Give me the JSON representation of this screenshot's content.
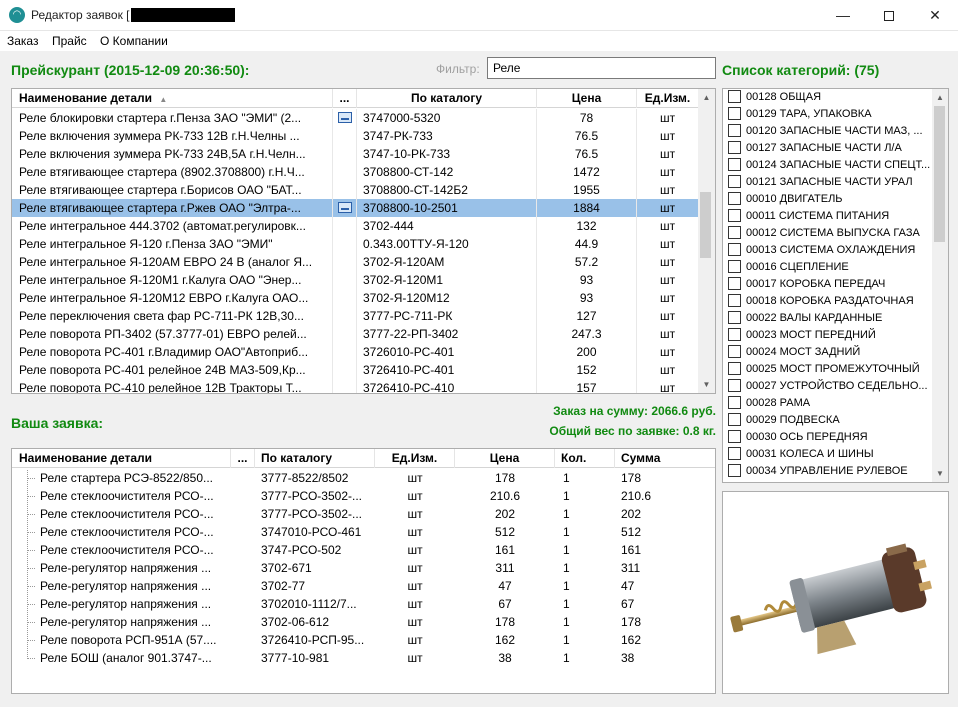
{
  "window": {
    "title": "Редактор заявок  [",
    "minimize": "—",
    "close": "✕"
  },
  "menu": [
    "Заказ",
    "Прайс",
    "О Компании"
  ],
  "price": {
    "title": "Прейскурант (2015-12-09 20:36:50):",
    "filter_label": "Фильтр:",
    "filter_value": "Реле",
    "columns": {
      "name": "Наименование детали",
      "sort_arrow": "▲",
      "pic": "...",
      "catalog": "По каталогу",
      "price": "Цена",
      "unit": "Ед.Изм."
    },
    "rows": [
      {
        "name": "Реле блокировки стартера г.Пенза ЗАО \"ЭМИ\" (2...",
        "pic": true,
        "catalog": "3747000-5320",
        "price": "78",
        "unit": "шт"
      },
      {
        "name": "Реле включения зуммера РК-733 12В г.Н.Челны ...",
        "pic": false,
        "catalog": "3747-РК-733",
        "price": "76.5",
        "unit": "шт"
      },
      {
        "name": "Реле включения зуммера РК-733 24В,5А г.Н.Челн...",
        "pic": false,
        "catalog": "3747-10-РК-733",
        "price": "76.5",
        "unit": "шт"
      },
      {
        "name": "Реле втягивающее стартера (8902.3708800) г.Н.Ч...",
        "pic": false,
        "catalog": "3708800-СТ-142",
        "price": "1472",
        "unit": "шт"
      },
      {
        "name": "Реле втягивающее стартера г.Борисов ОАО \"БАТ...",
        "pic": false,
        "catalog": "3708800-СТ-142Б2",
        "price": "1955",
        "unit": "шт"
      },
      {
        "name": "Реле втягивающее стартера г.Ржев ОАО \"Элтра-...",
        "pic": true,
        "catalog": "3708800-10-2501",
        "price": "1884",
        "unit": "шт",
        "selected": true
      },
      {
        "name": "Реле интегральное 444.3702 (автомат.регулировк...",
        "pic": false,
        "catalog": "3702-444",
        "price": "132",
        "unit": "шт"
      },
      {
        "name": "Реле интегральное Я-120 г.Пенза ЗАО \"ЭМИ\"",
        "pic": false,
        "catalog": "0.343.00ТТУ-Я-120",
        "price": "44.9",
        "unit": "шт"
      },
      {
        "name": "Реле интегральное Я-120АМ ЕВРО 24 В (аналог Я...",
        "pic": false,
        "catalog": "3702-Я-120АМ",
        "price": "57.2",
        "unit": "шт"
      },
      {
        "name": "Реле интегральное Я-120М1 г.Калуга ОАО \"Энер...",
        "pic": false,
        "catalog": "3702-Я-120М1",
        "price": "93",
        "unit": "шт"
      },
      {
        "name": "Реле интегральное Я-120М12 ЕВРО г.Калуга ОАО...",
        "pic": false,
        "catalog": "3702-Я-120М12",
        "price": "93",
        "unit": "шт"
      },
      {
        "name": "Реле переключения света фар РС-711-РК 12В,30...",
        "pic": false,
        "catalog": "3777-РС-711-РК",
        "price": "127",
        "unit": "шт"
      },
      {
        "name": "Реле поворота РП-3402 (57.3777-01) ЕВРО релей...",
        "pic": false,
        "catalog": "3777-22-РП-3402",
        "price": "247.3",
        "unit": "шт"
      },
      {
        "name": "Реле поворота РС-401 г.Владимир ОАО\"Автоприб...",
        "pic": false,
        "catalog": "3726010-РС-401",
        "price": "200",
        "unit": "шт"
      },
      {
        "name": "Реле поворота РС-401 релейное 24В МАЗ-509,Кр...",
        "pic": false,
        "catalog": "3726410-РС-401",
        "price": "152",
        "unit": "шт"
      },
      {
        "name": "Реле поворота РС-410 релейное 12В Тракторы Т...",
        "pic": false,
        "catalog": "3726410-РС-410",
        "price": "157",
        "unit": "шт"
      }
    ]
  },
  "order": {
    "title": "Ваша заявка:",
    "total_sum": "Заказ на сумму: 2066.6 руб.",
    "total_weight": "Общий вес по заявке: 0.8 кг.",
    "columns": {
      "name": "Наименование детали",
      "pic": "...",
      "catalog": "По каталогу",
      "unit": "Ед.Изм.",
      "price": "Цена",
      "qty": "Кол.",
      "sum": "Сумма"
    },
    "rows": [
      {
        "name": "Реле стартера  РСЭ-8522/850...",
        "catalog": "3777-8522/8502",
        "unit": "шт",
        "price": "178",
        "qty": "1",
        "sum": "178"
      },
      {
        "name": "Реле стеклоочистителя РСО-...",
        "catalog": "3777-РСО-3502-...",
        "unit": "шт",
        "price": "210.6",
        "qty": "1",
        "sum": "210.6"
      },
      {
        "name": "Реле стеклоочистителя РСО-...",
        "catalog": "3777-РСО-3502-...",
        "unit": "шт",
        "price": "202",
        "qty": "1",
        "sum": "202"
      },
      {
        "name": "Реле стеклоочистителя РСО-...",
        "catalog": "3747010-РСО-461",
        "unit": "шт",
        "price": "512",
        "qty": "1",
        "sum": "512"
      },
      {
        "name": "Реле стеклоочистителя РСО-...",
        "catalog": "3747-РСО-502",
        "unit": "шт",
        "price": "161",
        "qty": "1",
        "sum": "161"
      },
      {
        "name": "Реле-регулятор напряжения ...",
        "catalog": "3702-671",
        "unit": "шт",
        "price": "311",
        "qty": "1",
        "sum": "311"
      },
      {
        "name": "Реле-регулятор напряжения ...",
        "catalog": "3702-77",
        "unit": "шт",
        "price": "47",
        "qty": "1",
        "sum": "47"
      },
      {
        "name": "Реле-регулятор напряжения ...",
        "catalog": "3702010-1112/7...",
        "unit": "шт",
        "price": "67",
        "qty": "1",
        "sum": "67"
      },
      {
        "name": "Реле-регулятор напряжения ...",
        "catalog": "3702-06-612",
        "unit": "шт",
        "price": "178",
        "qty": "1",
        "sum": "178"
      },
      {
        "name": "Реле поворота РСП-951А (57....",
        "catalog": "3726410-РСП-95...",
        "unit": "шт",
        "price": "162",
        "qty": "1",
        "sum": "162"
      },
      {
        "name": "Реле БОШ (аналог 901.3747-...",
        "catalog": "3777-10-981",
        "unit": "шт",
        "price": "38",
        "qty": "1",
        "sum": "38"
      }
    ]
  },
  "categories": {
    "title": "Список категорий: (75)",
    "items": [
      "00128 ОБЩАЯ",
      "00129 ТАРА, УПАКОВКА",
      "00120 ЗАПАСНЫЕ ЧАСТИ МАЗ, ...",
      "00127 ЗАПАСНЫЕ ЧАСТИ Л/А",
      "00124 ЗАПАСНЫЕ ЧАСТИ СПЕЦТ...",
      "00121 ЗАПАСНЫЕ ЧАСТИ УРАЛ",
      "00010 ДВИГАТЕЛЬ",
      "00011 СИСТЕМА ПИТАНИЯ",
      "00012 СИСТЕМА ВЫПУСКА ГАЗА",
      "00013 СИСТЕМА ОХЛАЖДЕНИЯ",
      "00016 СЦЕПЛЕНИЕ",
      "00017 КОРОБКА ПЕРЕДАЧ",
      "00018 КОРОБКА РАЗДАТОЧНАЯ",
      "00022 ВАЛЫ КАРДАННЫЕ",
      "00023 МОСТ ПЕРЕДНИЙ",
      "00024 МОСТ ЗАДНИЙ",
      "00025 МОСТ ПРОМЕЖУТОЧНЫЙ",
      "00027 УСТРОЙСТВО СЕДЕЛЬНО...",
      "00028 РАМА",
      "00029 ПОДВЕСКА",
      "00030 ОСЬ ПЕРЕДНЯЯ",
      "00031 КОЛЕСА И ШИНЫ",
      "00034 УПРАВЛЕНИЕ РУЛЕВОЕ"
    ]
  },
  "scroll": {
    "up": "▲",
    "down": "▼"
  }
}
